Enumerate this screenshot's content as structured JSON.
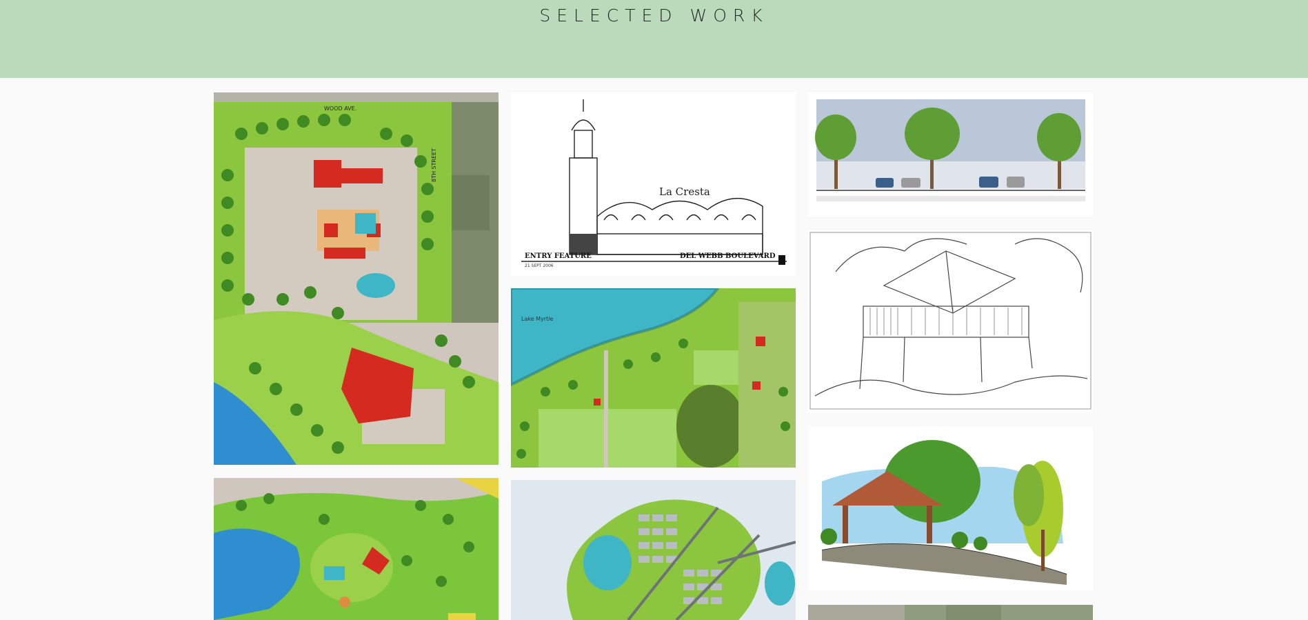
{
  "header": {
    "title": "SELECTED WORK"
  },
  "gallery": {
    "items": [
      {
        "alt": "Site plan",
        "labels": {
          "street_top": "WOOD AVE.",
          "street_side": "8TH STREET"
        }
      },
      {
        "alt": "Entry feature elevation",
        "labels": {
          "sign": "La Cresta",
          "caption_left": "ENTRY FEATURE",
          "caption_right": "DEL WEBB BOULEVARD",
          "date": "21 SEPT 2006"
        }
      },
      {
        "alt": "Street section"
      },
      {
        "alt": "Lake park plan",
        "labels": {
          "lake": "Lake Myrtle"
        }
      },
      {
        "alt": "Pavilion sketch"
      },
      {
        "alt": "Pool plan"
      },
      {
        "alt": "Subdivision plan"
      },
      {
        "alt": "Gazebo rendering"
      },
      {
        "alt": "Aerial"
      }
    ]
  },
  "colors": {
    "header_bg": "#bbdabc",
    "page_bg": "#fafafa",
    "roof_red": "#d42a20",
    "grass": "#8cc63e",
    "water": "#3fb6c6"
  }
}
